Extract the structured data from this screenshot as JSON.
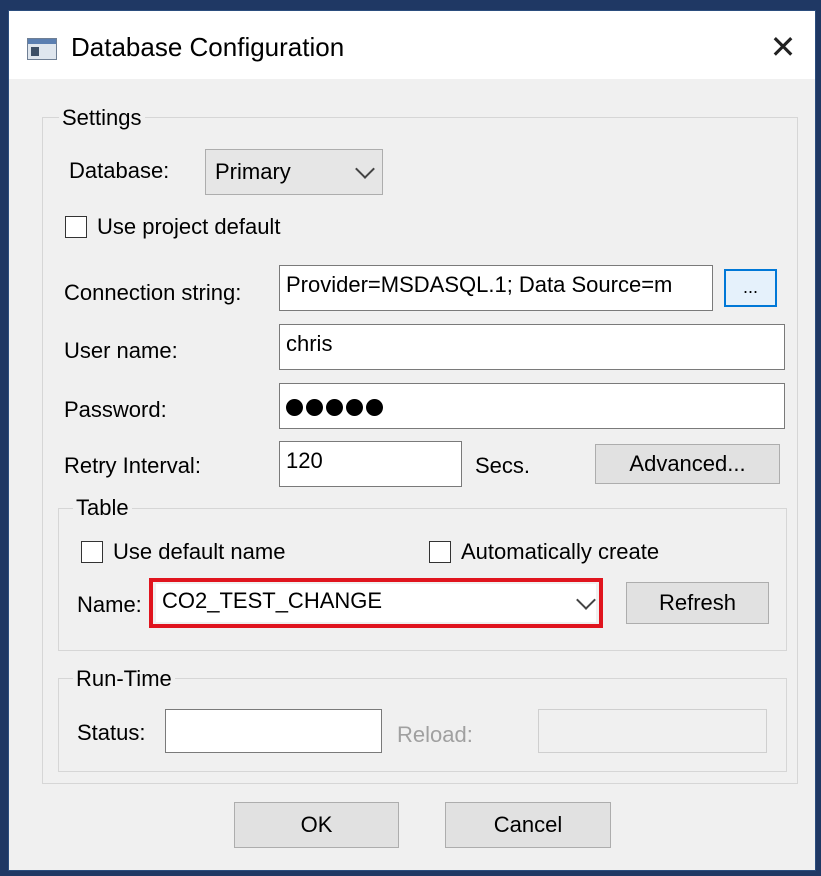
{
  "window": {
    "title": "Database Configuration",
    "close_glyph": "✕"
  },
  "settings": {
    "legend": "Settings",
    "database_label": "Database:",
    "database_value": "Primary",
    "use_project_default": {
      "label": "Use project default",
      "checked": false
    },
    "connection_string_label": "Connection string:",
    "connection_string_value": "Provider=MSDASQL.1; Data Source=m",
    "browse_label": "...",
    "user_name_label": "User name:",
    "user_name_value": "chris",
    "password_label": "Password:",
    "password_mask_count": 5,
    "retry_label": "Retry Interval:",
    "retry_value": "120",
    "secs_label": "Secs.",
    "advanced_label": "Advanced..."
  },
  "table": {
    "legend": "Table",
    "use_default_name": {
      "label": "Use default name",
      "checked": false
    },
    "auto_create": {
      "label": "Automatically create",
      "checked": false
    },
    "name_label": "Name:",
    "name_value": "CO2_TEST_CHANGE",
    "refresh_label": "Refresh",
    "highlight_color": "#e0141e"
  },
  "runtime": {
    "legend": "Run-Time",
    "status_label": "Status:",
    "status_value": "",
    "reload_label": "Reload:",
    "reload_value": ""
  },
  "buttons": {
    "ok_label": "OK",
    "cancel_label": "Cancel"
  },
  "icons": {
    "app": "window-app-icon",
    "close": "close-icon",
    "dropdown": "chevron-down-icon"
  },
  "colors": {
    "accent_border": "#0078d7",
    "frame": "#1f3864",
    "dialog_bg": "#f0f0f0"
  }
}
